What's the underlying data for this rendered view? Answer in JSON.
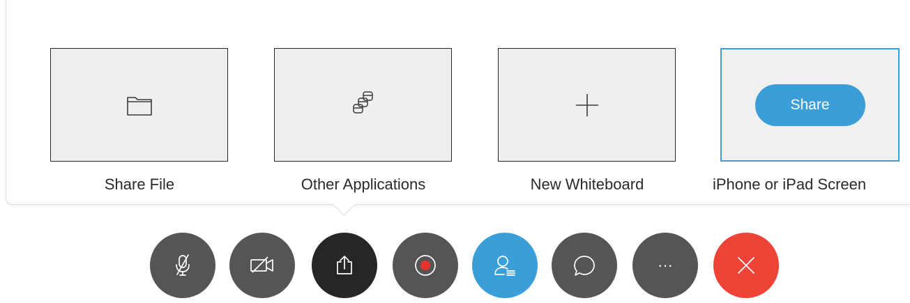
{
  "share_options": [
    {
      "label": "Share File",
      "icon": "folder-icon"
    },
    {
      "label": "Other Applications",
      "icon": "applications-stack-icon"
    },
    {
      "label": "New Whiteboard",
      "icon": "plus-icon"
    },
    {
      "label": "iPhone or iPad Screen",
      "button_label": "Share",
      "selected": true
    }
  ],
  "toolbar": {
    "buttons": [
      {
        "name": "mute-microphone",
        "icon": "microphone-muted-icon"
      },
      {
        "name": "stop-video",
        "icon": "video-off-icon"
      },
      {
        "name": "share-content",
        "icon": "share-upload-icon"
      },
      {
        "name": "record",
        "icon": "record-icon"
      },
      {
        "name": "participants",
        "icon": "participants-icon"
      },
      {
        "name": "chat",
        "icon": "chat-bubble-icon"
      },
      {
        "name": "more-options",
        "icon": "more-horizontal-icon",
        "label": "···"
      },
      {
        "name": "leave-meeting",
        "icon": "close-icon"
      }
    ]
  },
  "colors": {
    "accent": "#3a9fd8",
    "danger": "#ee4337",
    "record_dot": "#e5322d",
    "button_dark": "#555555",
    "button_active": "#262626"
  }
}
